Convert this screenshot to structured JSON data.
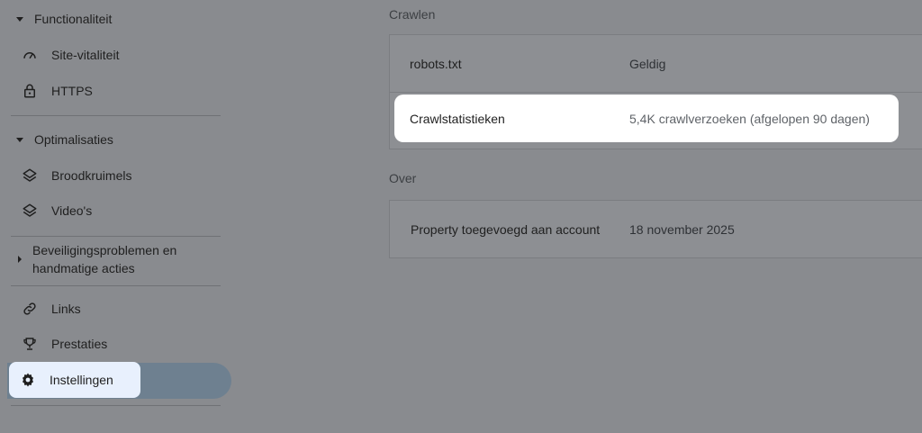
{
  "sidebar": {
    "sections": {
      "functionaliteit": "Functionaliteit",
      "optimalisaties": "Optimalisaties",
      "beveiliging_line1": "Beveiligingsproblemen en",
      "beveiliging_line2": "handmatige acties"
    },
    "items": {
      "site_vitaliteit": "Site-vitaliteit",
      "https": "HTTPS",
      "broodkruimels": "Broodkruimels",
      "videos": "Video's",
      "links": "Links",
      "prestaties": "Prestaties",
      "instellingen": "Instellingen"
    },
    "icons": {
      "site_vitaliteit": "gauge-icon",
      "https": "lock-icon",
      "broodkruimels": "layers-icon",
      "videos": "layers-icon",
      "links": "link-icon",
      "prestaties": "trophy-icon",
      "instellingen": "gear-icon"
    }
  },
  "main": {
    "crawl_title": "Crawlen",
    "crawl_rows": [
      {
        "label": "robots.txt",
        "value": "Geldig"
      },
      {
        "label": "Crawlstatistieken",
        "value": "5,4K crawlverzoeken (afgelopen 90 dagen)"
      }
    ],
    "over_title": "Over",
    "over_rows": [
      {
        "label": "Property toegevoegd aan account",
        "value": "18 november 2025"
      }
    ]
  },
  "colors": {
    "overlay_background": "#898b8f",
    "selected_pill": "#6e8090",
    "selected_highlight": "#e8f0fd",
    "highlight_row": "#ffffff"
  }
}
